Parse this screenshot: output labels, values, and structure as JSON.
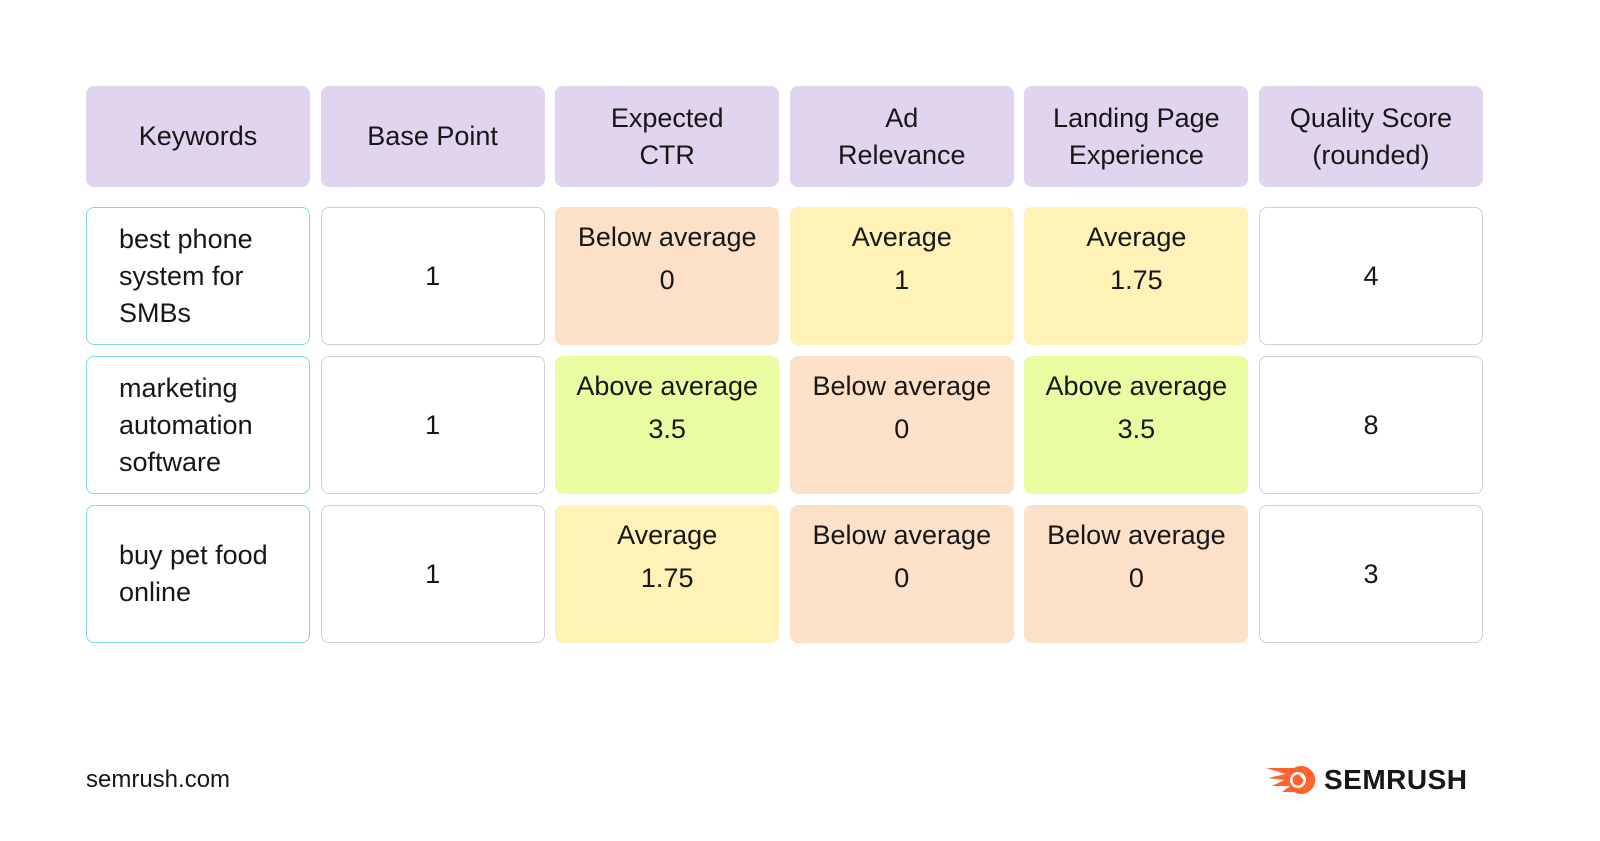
{
  "colors": {
    "header_bg": "#e0d4ee",
    "above_average": "#eafca2",
    "average": "#fef2b6",
    "below_average": "#fde0c8",
    "keyword_border": "#7dd8f3",
    "plain_border": "#cfcfcf",
    "brand_orange": "#ff642d"
  },
  "table": {
    "headers": [
      "Keywords",
      "Base Point",
      "Expected CTR",
      "Ad Relevance",
      "Landing Page Experience",
      "Quality Score (rounded)"
    ],
    "rows": [
      {
        "keyword": "best phone system for SMBs",
        "base_point": "1",
        "expected_ctr": {
          "rating": "Below average",
          "value": "0"
        },
        "ad_relevance": {
          "rating": "Average",
          "value": "1"
        },
        "landing_page": {
          "rating": "Average",
          "value": "1.75"
        },
        "quality_score": "4"
      },
      {
        "keyword": "marketing automation software",
        "base_point": "1",
        "expected_ctr": {
          "rating": "Above average",
          "value": "3.5"
        },
        "ad_relevance": {
          "rating": "Below average",
          "value": "0"
        },
        "landing_page": {
          "rating": "Above average",
          "value": "3.5"
        },
        "quality_score": "8"
      },
      {
        "keyword": "buy pet food online",
        "base_point": "1",
        "expected_ctr": {
          "rating": "Average",
          "value": "1.75"
        },
        "ad_relevance": {
          "rating": "Below average",
          "value": "0"
        },
        "landing_page": {
          "rating": "Below average",
          "value": "0"
        },
        "quality_score": "3"
      }
    ]
  },
  "footer": {
    "url": "semrush.com",
    "brand": "SEMRUSH",
    "logo_icon": "semrush-fireball-icon"
  }
}
